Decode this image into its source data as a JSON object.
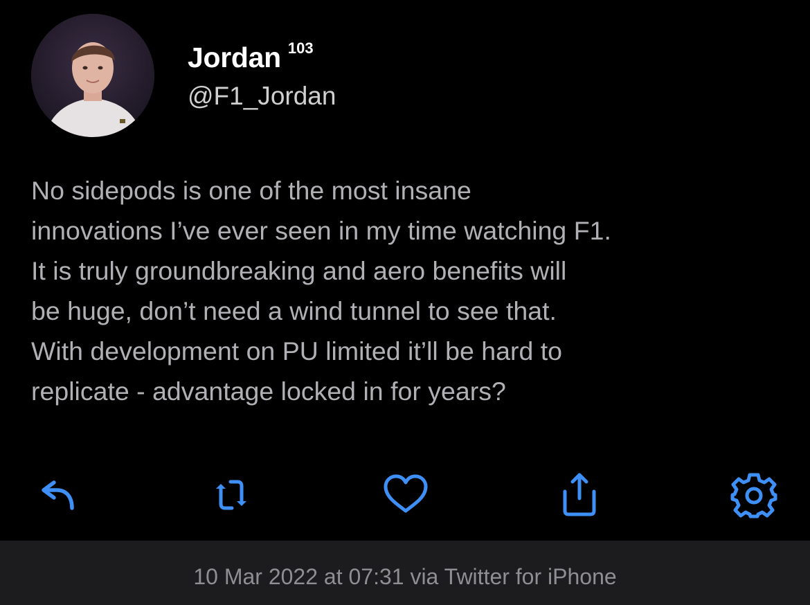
{
  "user": {
    "display_name": "Jordan",
    "follower_count": "103",
    "handle": "@F1_Jordan"
  },
  "tweet": {
    "lines": [
      "No sidepods is one of the most insane",
      "innovations I’ve ever seen in my time watching F1.",
      "It is truly groundbreaking and aero benefits will",
      "be huge, don’t need a wind tunnel to see that.",
      "With development on PU limited it’ll be hard to",
      "replicate - advantage locked in for years?"
    ]
  },
  "actions": {
    "icons": [
      "reply-icon",
      "retweet-icon",
      "heart-icon",
      "share-icon",
      "gear-icon"
    ],
    "accent_color": "#3e8ff6"
  },
  "footer": {
    "timestamp_source": "10 Mar 2022 at 07:31 via Twitter for iPhone"
  },
  "colors": {
    "background": "#000000",
    "footer_background": "#1c1c1e",
    "body_text": "#b0b0b5",
    "footer_text": "#8e8e93"
  }
}
